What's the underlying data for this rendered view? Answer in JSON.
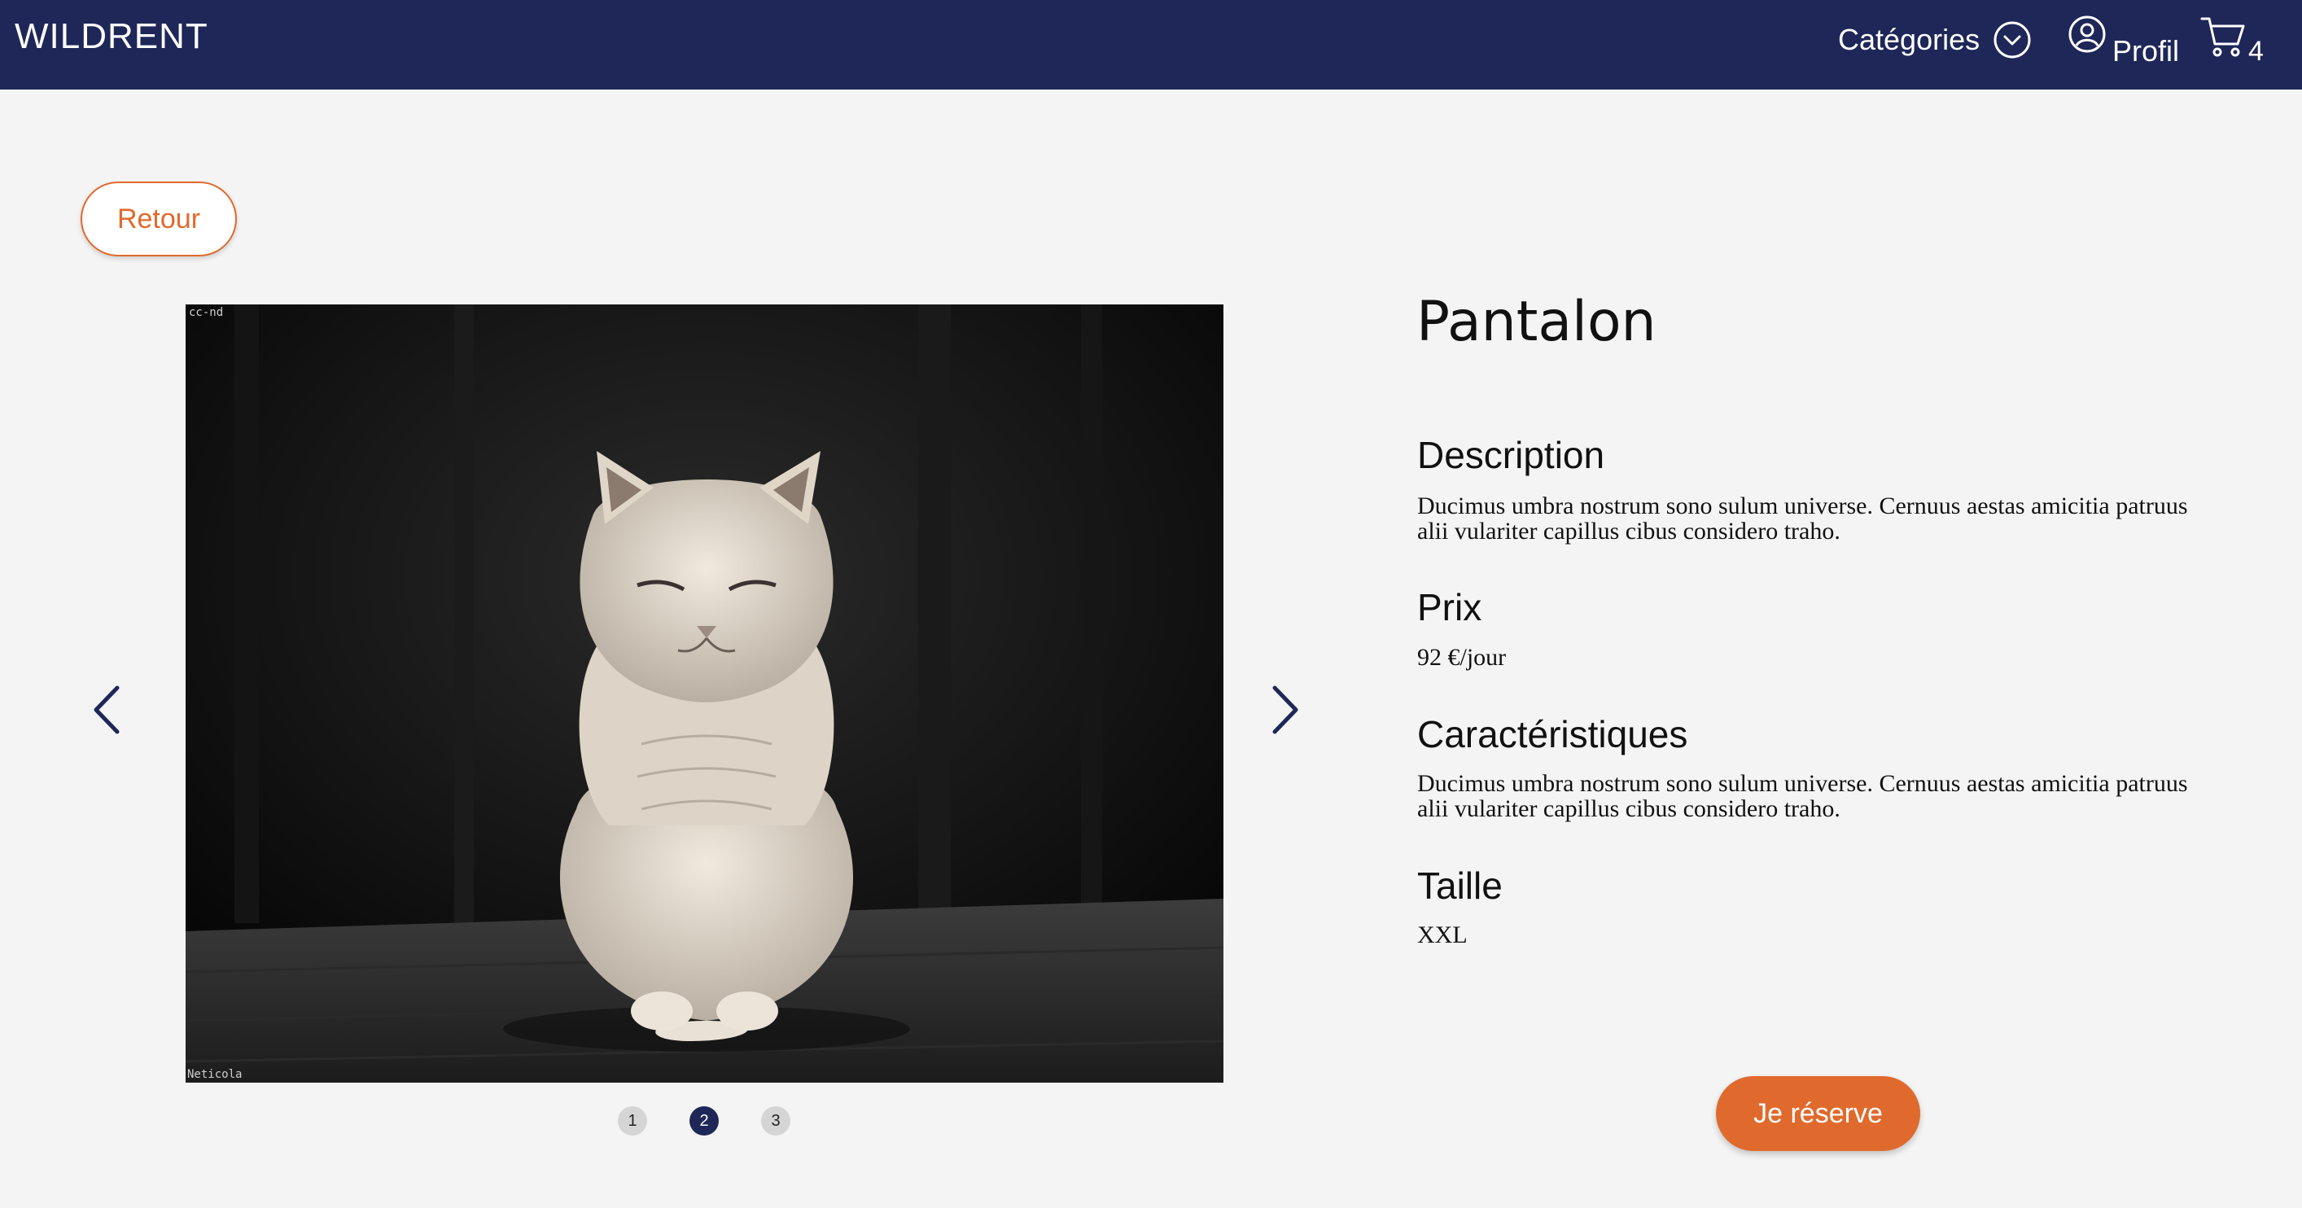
{
  "navbar": {
    "logo": "WILDRENT",
    "categories_label": "Catégories",
    "profile_label": "Profil",
    "cart_count": "4",
    "background_color": "#1e2758"
  },
  "back_button": {
    "label": "Retour"
  },
  "carousel": {
    "image_watermark_top": "cc-nd",
    "image_watermark_bottom": "Neticola",
    "image_subject": "cat-photo",
    "dots": [
      "1",
      "2",
      "3"
    ],
    "active_dot_index": 1
  },
  "product": {
    "title": "Pantalon",
    "description_heading": "Description",
    "description_text": "Ducimus umbra nostrum sono sulum universe. Cernuus aestas amicitia patruus alii vulariter capillus cibus considero traho.",
    "price_heading": "Prix",
    "price_text": "92 €/jour",
    "features_heading": "Caractéristiques",
    "features_text": "Ducimus umbra nostrum sono sulum universe. Cernuus aestas amicitia patruus alii vulariter capillus cibus considero traho.",
    "size_heading": "Taille",
    "size_text": "XXL"
  },
  "reserve_button": {
    "label": "Je réserve"
  },
  "colors": {
    "accent": "#e06a2d",
    "primary": "#1e2758",
    "background": "#f4f4f4"
  }
}
